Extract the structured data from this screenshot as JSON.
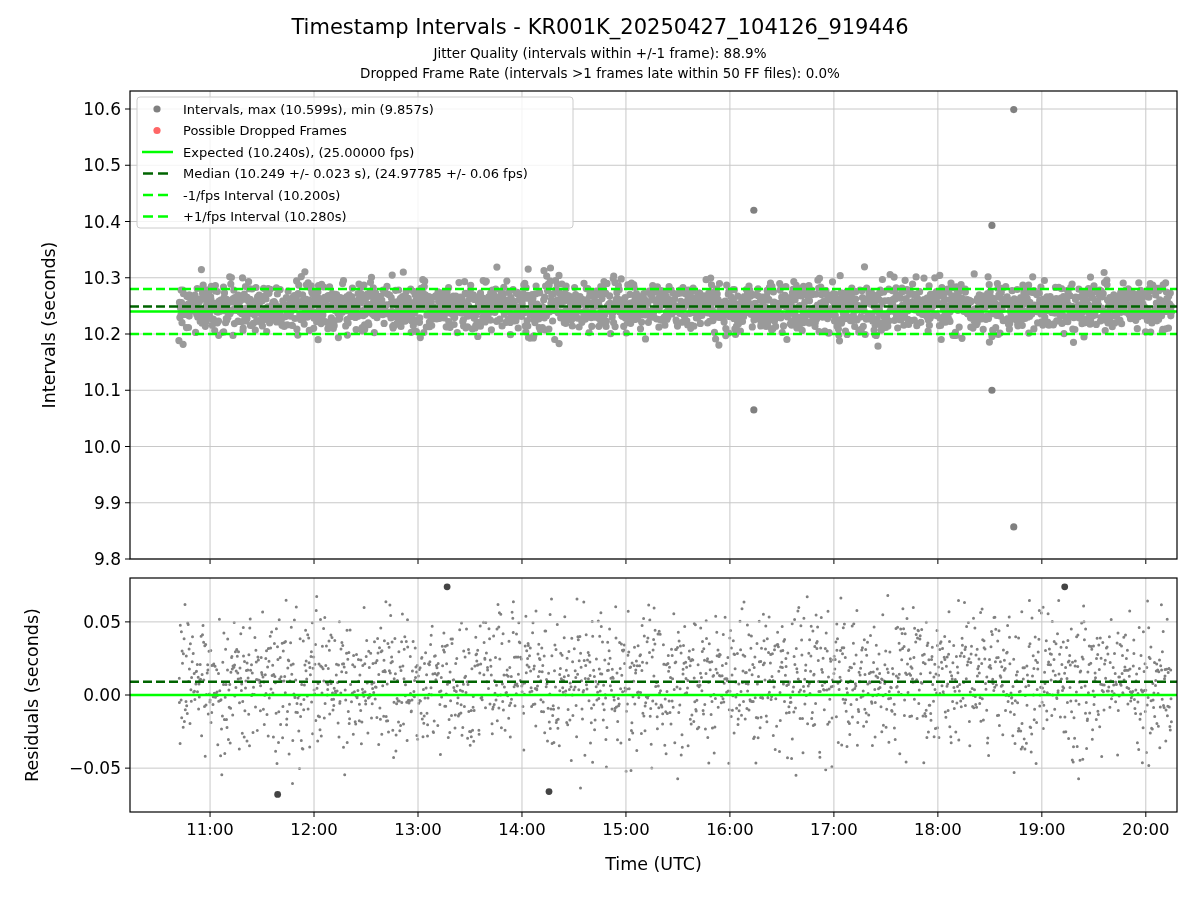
{
  "figure": {
    "title": "Timestamp Intervals - KR001K_20250427_104126_919446",
    "subtitles": [
      "Jitter Quality (intervals within +/-1 frame): 88.9%",
      "Dropped Frame Rate (intervals >1 frames late within 50 FF files): 0.0%"
    ]
  },
  "top_panel": {
    "chart_data": {
      "type": "scatter",
      "ylabel": "Intervals (seconds)",
      "x": [
        16.23,
        16.23,
        18.52,
        18.52,
        18.73,
        18.73
      ],
      "series": [
        {
          "name": "Intervals, max (10.599s), min (9.857s)",
          "color": "#808080",
          "values": [
            10.42,
            10.065,
            10.393,
            10.1,
            10.599,
            9.857
          ]
        },
        {
          "name": "Possible Dropped Frames",
          "color": "#ff6666",
          "values": [
            null,
            null,
            null,
            null,
            null,
            null
          ]
        }
      ],
      "xlim": [
        10.23,
        20.3
      ],
      "ylim": [
        9.8,
        10.632
      ],
      "grid": true,
      "legend": "upper left",
      "yticks": [
        {
          "value": 9.8,
          "label": "9.8"
        },
        {
          "value": 9.9,
          "label": "9.9"
        },
        {
          "value": 10.0,
          "label": "10.0"
        },
        {
          "value": 10.1,
          "label": "10.1"
        },
        {
          "value": 10.2,
          "label": "10.2"
        },
        {
          "value": 10.3,
          "label": "10.3"
        },
        {
          "value": 10.4,
          "label": "10.4"
        },
        {
          "value": 10.5,
          "label": "10.5"
        },
        {
          "value": 10.6,
          "label": "10.6"
        }
      ],
      "ref_lines": [
        {
          "axis": "y",
          "value": 10.24,
          "label": "Expected (10.240s), (25.00000 fps)",
          "color": "#00ff00"
        },
        {
          "axis": "y",
          "value": 10.249,
          "label": "Median (10.249 +/- 0.023 s), (24.97785 +/- 0.06 fps)",
          "color": "#006400"
        },
        {
          "axis": "y",
          "value": 10.2,
          "label": "-1/fps Interval (10.200s)",
          "color": "#00fe00"
        },
        {
          "axis": "y",
          "value": 10.28,
          "label": "+1/fps Interval (10.280s)",
          "color": "#00ff01"
        }
      ]
    }
  },
  "bottom_panel": {
    "chart_data": {
      "type": "scatter",
      "xlabel": "Time (UTC)",
      "ylabel": "Residuals (seconds)",
      "x": [
        11.65,
        13.28,
        14.26,
        19.22
      ],
      "series": [
        {
          "color": "#444444",
          "values": [
            -0.068,
            0.074,
            -0.066,
            0.074
          ]
        }
      ],
      "xlim": [
        10.23,
        20.3
      ],
      "ylim": [
        -0.08,
        0.08
      ],
      "grid": true,
      "xticks": [
        {
          "value": 11,
          "label": "11:00"
        },
        {
          "value": 12,
          "label": "12:00"
        },
        {
          "value": 13,
          "label": "13:00"
        },
        {
          "value": 14,
          "label": "14:00"
        },
        {
          "value": 15,
          "label": "15:00"
        },
        {
          "value": 16,
          "label": "16:00"
        },
        {
          "value": 17,
          "label": "17:00"
        },
        {
          "value": 18,
          "label": "18:00"
        },
        {
          "value": 19,
          "label": "19:00"
        },
        {
          "value": 20,
          "label": "20:00"
        }
      ],
      "yticks": [
        {
          "value": -0.05,
          "label": "−0.05"
        },
        {
          "value": 0,
          "label": "0.00"
        },
        {
          "value": 0.05,
          "label": "0.05"
        }
      ],
      "ref_lines": [
        {
          "axis": "y",
          "value": 0.009,
          "color": "#006400"
        },
        {
          "axis": "y",
          "value": 0,
          "color": "#00ff00"
        }
      ]
    }
  }
}
